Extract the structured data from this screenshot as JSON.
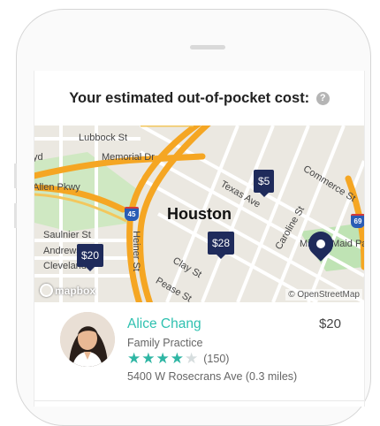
{
  "header": {
    "title": "Your estimated out-of-pocket cost:",
    "help_icon": "question-icon",
    "help_glyph": "?"
  },
  "map": {
    "city_label": "Houston",
    "streets": [
      "Lubbock St",
      "Memorial Dr",
      "Allen Pkwy",
      "Texas Ave",
      "Commerce St",
      "Caroline St",
      "Saulnier St",
      "Andrews",
      "Cleveland",
      "Heiner St",
      "Clay St",
      "Pease St",
      "Minute Maid Park",
      "yd"
    ],
    "price_pins": [
      "$5",
      "$28",
      "$20"
    ],
    "highway_shields": [
      "45",
      "69"
    ],
    "mapbox_label": "mapbox",
    "osm_attribution": "© OpenStreetMap",
    "colors": {
      "major_road": "#f5a623",
      "pin": "#1f2b5b",
      "park": "#bfe3b4"
    }
  },
  "doctor": {
    "name": "Alice Chang",
    "price": "$20",
    "specialty": "Family Practice",
    "rating": 4,
    "stars": [
      "★",
      "★",
      "★",
      "★",
      "★"
    ],
    "reviews": "(150)",
    "address": "5400 W Rosecrans Ave (0.3 miles)",
    "accent_color": "#2fc1b0"
  }
}
